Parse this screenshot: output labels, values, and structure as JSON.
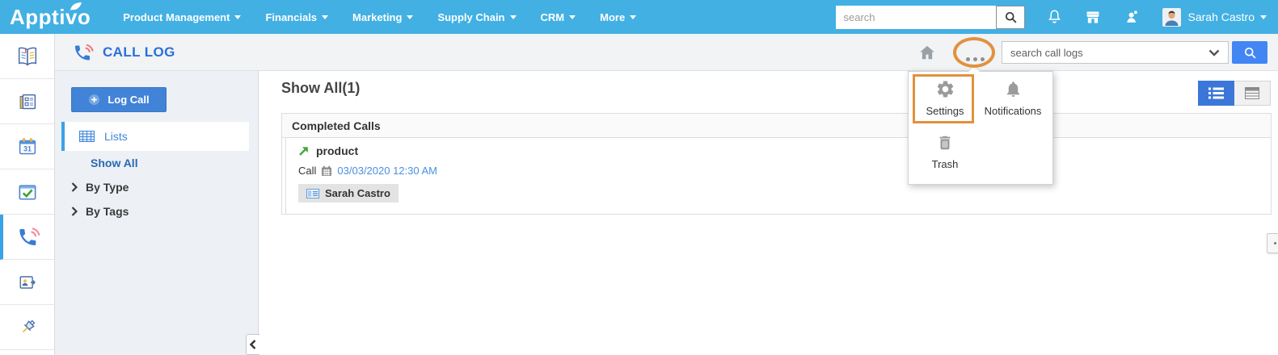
{
  "topbar": {
    "logo": "Apptivo",
    "nav": [
      "Product Management",
      "Financials",
      "Marketing",
      "Supply Chain",
      "CRM",
      "More"
    ],
    "search_placeholder": "search",
    "user_name": "Sarah Castro"
  },
  "app_header": {
    "title": "CALL LOG",
    "search_placeholder": "search call logs"
  },
  "dock": {
    "items": [
      "book",
      "newsfeed",
      "calendar",
      "tasks",
      "call-log",
      "contact-share",
      "pin"
    ],
    "active_item": "call-log"
  },
  "left_panel": {
    "log_call_button": "Log Call",
    "lists_label": "Lists",
    "show_all": "Show All",
    "by_type": "By Type",
    "by_tags": "By Tags"
  },
  "main": {
    "heading": "Show All(1)",
    "card_header": "Completed Calls",
    "record": {
      "title": "product",
      "type": "Call",
      "datetime": "03/03/2020 12:30 AM",
      "associated_contact": "Sarah Castro"
    }
  },
  "dropdown_menu": {
    "items": [
      {
        "label": "Settings"
      },
      {
        "label": "Notifications"
      },
      {
        "label": "Trash"
      }
    ],
    "highlighted": "Settings"
  },
  "colors": {
    "topbar_blue": "#42b0e3",
    "accent_blue": "#3b7dd9",
    "title_blue": "#2a6fdb",
    "link_blue": "#4a8fe0",
    "search_button_blue": "#4286f4",
    "annotation_orange": "#e2913d",
    "arrow_green": "#45a73c"
  }
}
